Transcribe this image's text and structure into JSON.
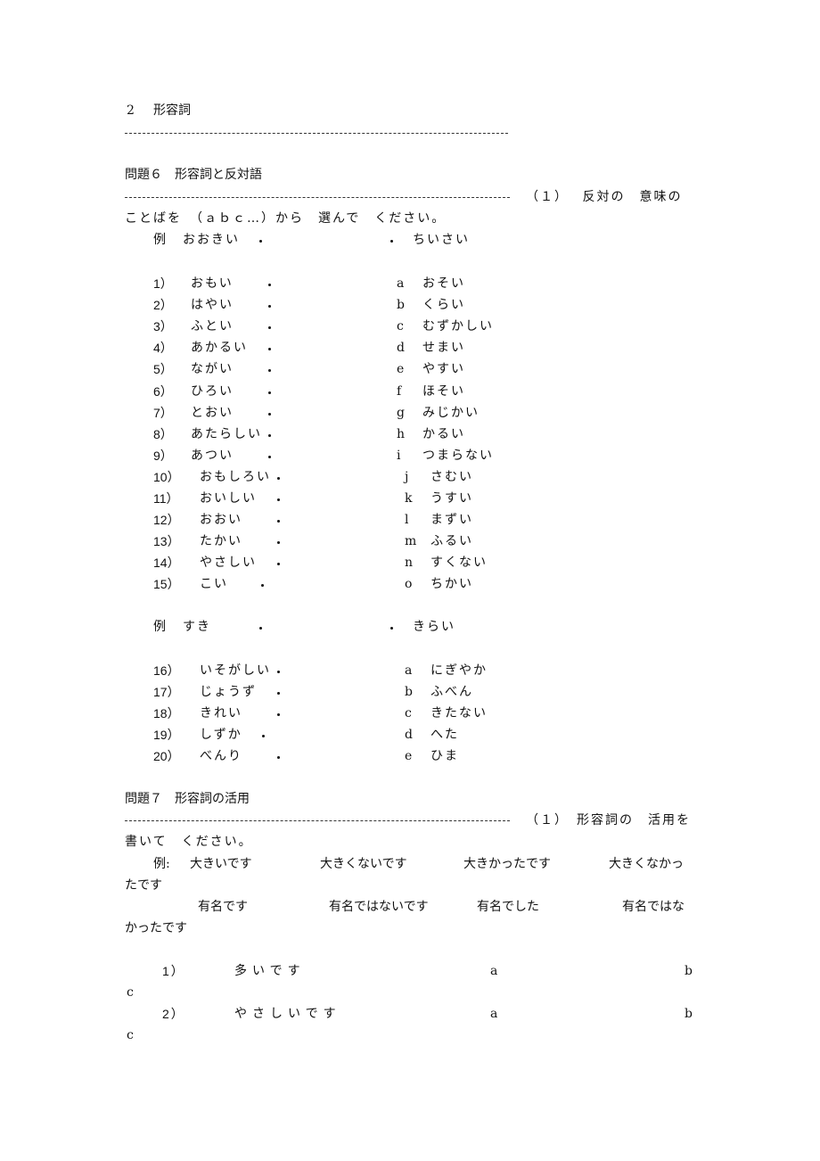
{
  "section": {
    "number": "2",
    "title": "形容詞"
  },
  "q6": {
    "title": "問題６　形容詞と反対語",
    "instruction_line1": "（１）　 反対の　意味の",
    "instruction_line2": "ことばを　（ａｂｃ…）から　選んで　ください。",
    "example1": {
      "label": "例",
      "left": "おおきい",
      "right": "ちいさい"
    },
    "left_items_1": [
      {
        "num": "1）",
        "word": "おもい"
      },
      {
        "num": "2）",
        "word": "はやい"
      },
      {
        "num": "3）",
        "word": "ふとい"
      },
      {
        "num": "4）",
        "word": "あかるい"
      },
      {
        "num": "5）",
        "word": "ながい"
      },
      {
        "num": "6）",
        "word": "ひろい"
      },
      {
        "num": "7）",
        "word": "とおい"
      },
      {
        "num": "8）",
        "word": "あたらしい"
      },
      {
        "num": "9）",
        "word": "あつい"
      },
      {
        "num": "10）",
        "word": "おもしろい"
      },
      {
        "num": "11）",
        "word": "おいしい"
      },
      {
        "num": "12）",
        "word": "おおい"
      },
      {
        "num": "13）",
        "word": "たかい"
      },
      {
        "num": "14）",
        "word": "やさしい"
      },
      {
        "num": "15）",
        "word": "こい"
      }
    ],
    "right_items_1": [
      {
        "letter": "a",
        "word": "おそい"
      },
      {
        "letter": "b",
        "word": "くらい"
      },
      {
        "letter": "c",
        "word": "むずかしい"
      },
      {
        "letter": "d",
        "word": "せまい"
      },
      {
        "letter": "e",
        "word": "やすい"
      },
      {
        "letter": "f",
        "word": "ほそい"
      },
      {
        "letter": "g",
        "word": "みじかい"
      },
      {
        "letter": "h",
        "word": "かるい"
      },
      {
        "letter": "i",
        "word": "つまらない"
      },
      {
        "letter": "j",
        "word": "さむい"
      },
      {
        "letter": "k",
        "word": "うすい"
      },
      {
        "letter": "l",
        "word": "まずい"
      },
      {
        "letter": "m",
        "word": "ふるい"
      },
      {
        "letter": "n",
        "word": "すくない"
      },
      {
        "letter": "o",
        "word": "ちかい"
      }
    ],
    "example2": {
      "label": "例",
      "left": "すき",
      "right": "きらい"
    },
    "left_items_2": [
      {
        "num": "16）",
        "word": "いそがしい"
      },
      {
        "num": "17）",
        "word": "じょうず"
      },
      {
        "num": "18）",
        "word": "きれい"
      },
      {
        "num": "19）",
        "word": "しずか"
      },
      {
        "num": "20）",
        "word": "べんり"
      }
    ],
    "right_items_2": [
      {
        "letter": "a",
        "word": "にぎやか"
      },
      {
        "letter": "b",
        "word": "ふべん"
      },
      {
        "letter": "c",
        "word": "きたない"
      },
      {
        "letter": "d",
        "word": "へた"
      },
      {
        "letter": "e",
        "word": "ひま"
      }
    ]
  },
  "q7": {
    "title": "問題７　形容詞の活用",
    "instruction_line1": "（１）　形容詞の　活用を",
    "instruction_line2": "書いて　ください。",
    "example_label": "例:",
    "example_row1": [
      "大きいです",
      "大きくないです",
      "大きかったです",
      "大きくなかっ"
    ],
    "example_row1_wrap": "たです",
    "example_row2": [
      "有名です",
      "有名ではないです",
      "有名でした",
      "有名ではな"
    ],
    "example_row2_wrap": "かったです",
    "items": [
      {
        "num": "1）",
        "word": "多いです",
        "a": "a",
        "b": "b",
        "c": "c"
      },
      {
        "num": "2）",
        "word": "やさしいです",
        "a": "a",
        "b": "b",
        "c": "c"
      }
    ]
  }
}
